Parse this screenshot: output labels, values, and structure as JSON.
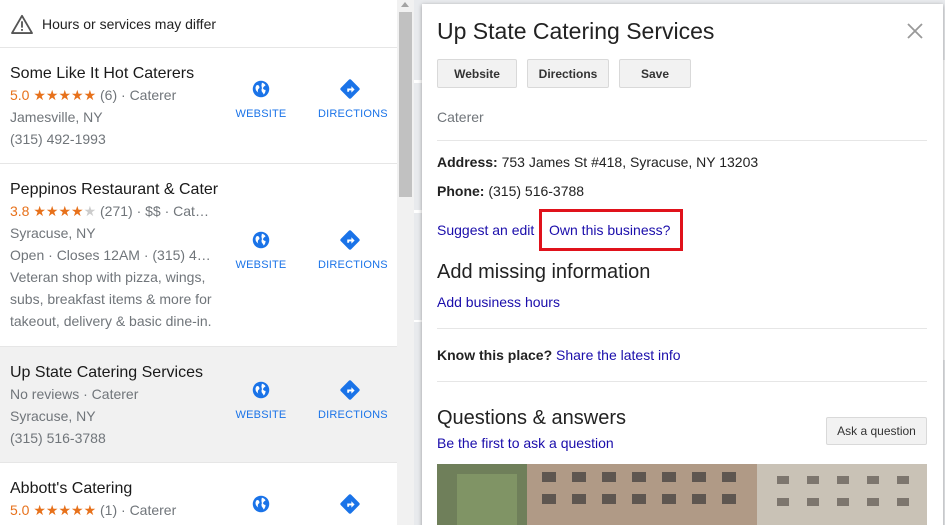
{
  "notice": {
    "text": "Hours or services may differ",
    "icon": "warning-icon"
  },
  "results": [
    {
      "name": "Some Like It Hot Caterers",
      "rating": "5.0",
      "stars": "★★★★★",
      "stars_off": "",
      "rating_value": 5.0,
      "meta": "(6) · Caterer",
      "lines": [
        "Jamesville, NY",
        "(315) 492-1993"
      ],
      "description": "",
      "website_label": "WEBSITE",
      "directions_label": "DIRECTIONS"
    },
    {
      "name": "Peppinos Restaurant & Cater",
      "rating": "3.8",
      "stars": "★★★★",
      "stars_off": "★",
      "rating_value": 3.8,
      "meta": "(271) · $$ · Cat…",
      "lines": [
        "Syracuse, NY",
        "Open · Closes 12AM · (315) 4…"
      ],
      "description": "Veteran shop with pizza, wings, subs, breakfast items & more for takeout, delivery & basic dine-in.",
      "website_label": "WEBSITE",
      "directions_label": "DIRECTIONS"
    },
    {
      "name": "Up State Catering Services",
      "rating": "",
      "stars": "",
      "stars_off": "",
      "meta": "No reviews · Caterer",
      "lines": [
        "Syracuse, NY",
        "(315) 516-3788"
      ],
      "description": "",
      "website_label": "WEBSITE",
      "directions_label": "DIRECTIONS"
    },
    {
      "name": "Abbott's Catering",
      "rating": "5.0",
      "stars": "★★★★★",
      "stars_off": "",
      "rating_value": 5.0,
      "meta": "(1) · Caterer",
      "lines": [],
      "description": "",
      "website_label": "WEBSITE",
      "directions_label": "DIRECTIONS"
    }
  ],
  "panel": {
    "title": "Up State Catering Services",
    "buttons": {
      "website": "Website",
      "directions": "Directions",
      "save": "Save"
    },
    "category": "Caterer",
    "address_label": "Address:",
    "address": "753 James St #418, Syracuse, NY 13203",
    "phone_label": "Phone:",
    "phone": "(315) 516-3788",
    "suggest_edit": "Suggest an edit",
    "own_business": "Own this business?",
    "missing_heading": "Add missing information",
    "add_hours": "Add business hours",
    "know_label": "Know this place?",
    "share_info": "Share the latest info",
    "qa_heading": "Questions & answers",
    "first_ask": "Be the first to ask a question",
    "ask_button": "Ask a question"
  },
  "colors": {
    "link": "#1a0dab",
    "action_blue": "#1a73e8",
    "star": "#e7711b",
    "highlight_box": "#e0121b"
  }
}
